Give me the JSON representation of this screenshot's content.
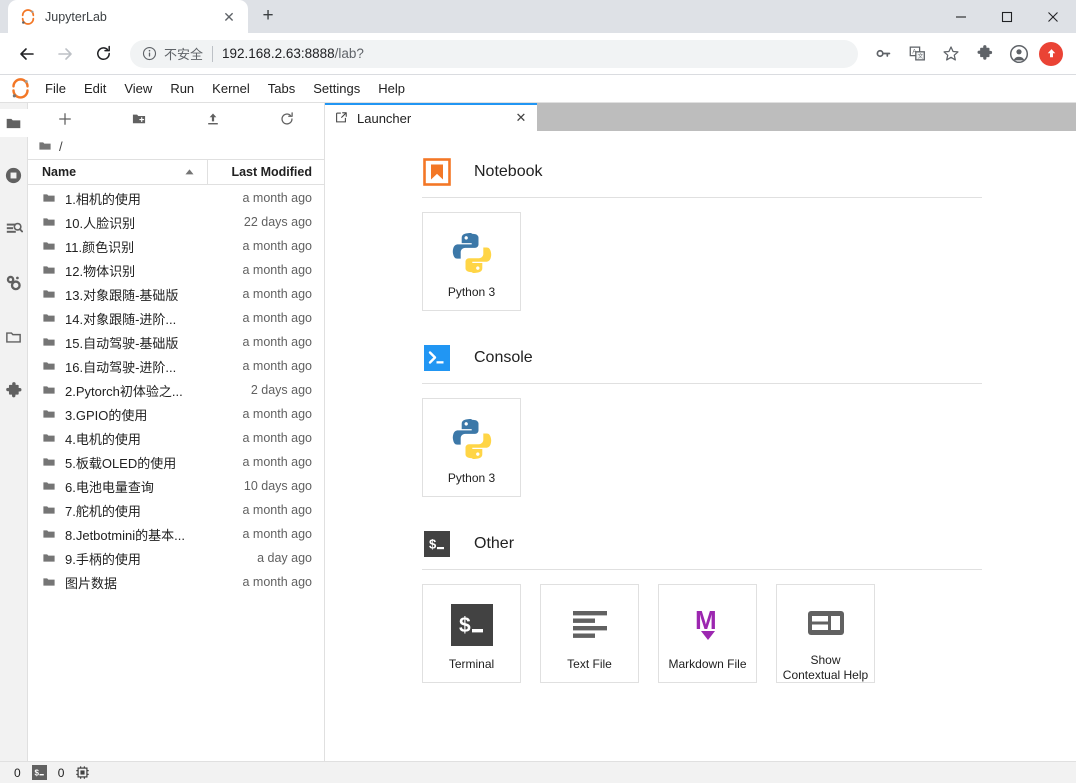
{
  "browser": {
    "tab": {
      "title": "JupyterLab",
      "favicon": "jupyter-logo-icon",
      "close_label": "✕"
    },
    "new_tab_label": "+",
    "window_controls": {
      "minimize": "—",
      "maximize": "□",
      "close": "✕"
    },
    "nav": {
      "back": "←",
      "forward": "→",
      "reload": "⟳"
    },
    "omnibox": {
      "info_icon": "info-circle-icon",
      "security_label": "不安全",
      "url_host": "192.168.2.63:8888",
      "url_path": "/lab?"
    },
    "toolbar_icons": [
      {
        "name": "password-key-icon",
        "glyph": "key"
      },
      {
        "name": "translate-icon",
        "glyph": "translate"
      },
      {
        "name": "bookmark-star-icon",
        "glyph": "star"
      },
      {
        "name": "extensions-puzzle-icon",
        "glyph": "puzzle"
      },
      {
        "name": "profile-avatar-icon",
        "glyph": "avatar"
      },
      {
        "name": "chrome-update-icon",
        "glyph": "update"
      }
    ]
  },
  "jupyter": {
    "menubar": [
      "File",
      "Edit",
      "View",
      "Run",
      "Kernel",
      "Tabs",
      "Settings",
      "Help"
    ],
    "activitybar": [
      {
        "name": "file-browser-icon",
        "label": "File Browser",
        "selected": true
      },
      {
        "name": "running-terminals-kernels-icon",
        "label": "Running Terminals and Kernels",
        "selected": false
      },
      {
        "name": "commands-icon",
        "label": "Commands",
        "selected": false
      },
      {
        "name": "property-inspector-icon",
        "label": "Property Inspector",
        "selected": false
      },
      {
        "name": "open-tabs-icon",
        "label": "Open Tabs",
        "selected": false
      },
      {
        "name": "extension-manager-icon",
        "label": "Extension Manager",
        "selected": false
      }
    ],
    "filebrowser": {
      "toolbar": [
        {
          "name": "new-launcher-button",
          "glyph": "plus"
        },
        {
          "name": "new-folder-button",
          "glyph": "new-folder"
        },
        {
          "name": "upload-button",
          "glyph": "upload"
        },
        {
          "name": "refresh-button",
          "glyph": "refresh"
        }
      ],
      "breadcrumb_root": "/",
      "columns": {
        "name": "Name",
        "last_modified": "Last Modified"
      },
      "sort_caret": "▲",
      "rows": [
        {
          "name": "1.相机的使用",
          "modified": "a month ago"
        },
        {
          "name": "10.人脸识别",
          "modified": "22 days ago"
        },
        {
          "name": "11.颜色识别",
          "modified": "a month ago"
        },
        {
          "name": "12.物体识别",
          "modified": "a month ago"
        },
        {
          "name": "13.对象跟随-基础版",
          "modified": "a month ago"
        },
        {
          "name": "14.对象跟随-进阶...",
          "modified": "a month ago"
        },
        {
          "name": "15.自动驾驶-基础版",
          "modified": "a month ago"
        },
        {
          "name": "16.自动驾驶-进阶...",
          "modified": "a month ago"
        },
        {
          "name": "2.Pytorch初体验之...",
          "modified": "2 days ago"
        },
        {
          "name": "3.GPIO的使用",
          "modified": "a month ago"
        },
        {
          "name": "4.电机的使用",
          "modified": "a month ago"
        },
        {
          "name": "5.板载OLED的使用",
          "modified": "a month ago"
        },
        {
          "name": "6.电池电量查询",
          "modified": "10 days ago"
        },
        {
          "name": "7.舵机的使用",
          "modified": "a month ago"
        },
        {
          "name": "8.Jetbotmini的基本...",
          "modified": "a month ago"
        },
        {
          "name": "9.手柄的使用",
          "modified": "a day ago"
        },
        {
          "name": "图片数据",
          "modified": "a month ago"
        }
      ]
    },
    "dock": {
      "tabs": [
        {
          "label": "Launcher",
          "icon": "launcher-icon",
          "close": "✕",
          "active": true
        }
      ]
    },
    "launcher": {
      "sections": [
        {
          "title": "Notebook",
          "icon": "notebook-bookmark-icon",
          "cards": [
            {
              "label": "Python 3",
              "icon": "python-logo-icon"
            }
          ]
        },
        {
          "title": "Console",
          "icon": "console-prompt-icon",
          "cards": [
            {
              "label": "Python 3",
              "icon": "python-logo-icon"
            }
          ]
        },
        {
          "title": "Other",
          "icon": "terminal-dollar-icon",
          "cards": [
            {
              "label": "Terminal",
              "icon": "terminal-dollar-icon"
            },
            {
              "label": "Text File",
              "icon": "text-lines-icon"
            },
            {
              "label": "Markdown File",
              "icon": "markdown-m-icon"
            },
            {
              "label": "Show Contextual Help",
              "icon": "contextual-help-panel-icon"
            }
          ]
        }
      ]
    },
    "statusbar": {
      "terminals_count": "0",
      "terminal_icon": "terminal-dollar-icon",
      "kernels_count": "0",
      "kernel_icon": "cpu-chip-icon"
    }
  },
  "colors": {
    "accent_blue": "#2196f3",
    "jupyter_orange": "#f37726",
    "python_blue": "#3c78a8",
    "python_yellow": "#ffd546",
    "markdown_purple": "#9c27b0",
    "terminal_dark": "#424242",
    "chrome_update_red": "#ea4335"
  }
}
